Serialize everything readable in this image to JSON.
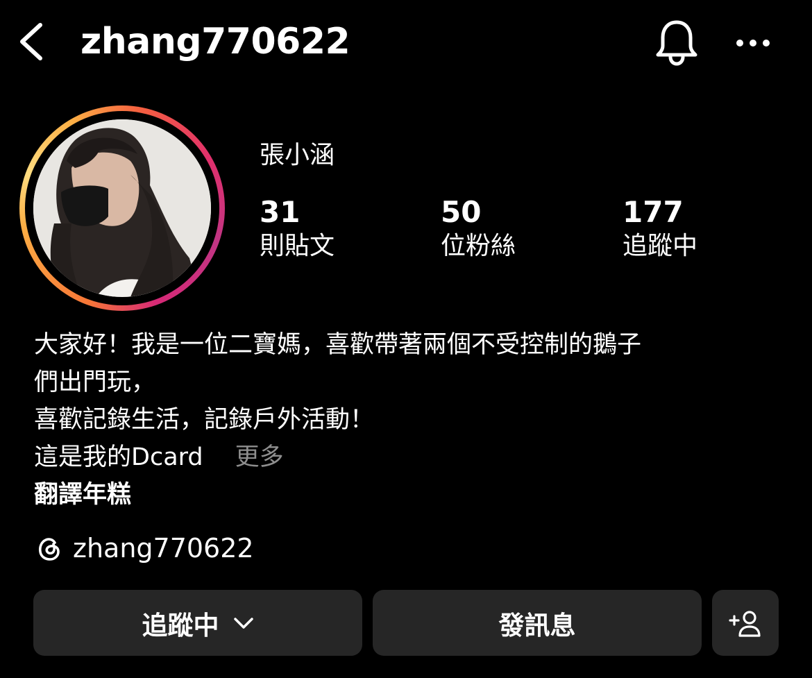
{
  "header": {
    "username": "zhang770622",
    "back_icon": "chevron-left-icon",
    "bell_icon": "bell-icon",
    "more_icon": "more-horizontal-icon"
  },
  "profile": {
    "display_name": "張小涵",
    "story_ring_colors": [
      "#fcaf45",
      "#f77737",
      "#e1306c",
      "#c13584"
    ],
    "stats": [
      {
        "count": "31",
        "label": "則貼文"
      },
      {
        "count": "50",
        "label": "位粉絲"
      },
      {
        "count": "177",
        "label": "追蹤中"
      }
    ]
  },
  "bio": {
    "lines": [
      "大家好！我是一位二寶媽，喜歡帶著兩個不受控制的鵝子",
      "們出門玩，",
      "喜歡記錄生活，記錄戶外活動！",
      "這是我的Dcard"
    ],
    "more_label": "更多",
    "translate_label": "翻譯年糕"
  },
  "threads": {
    "icon": "threads-icon",
    "handle": "zhang770622"
  },
  "actions": {
    "following_label": "追蹤中",
    "message_label": "發訊息",
    "add_user_icon": "add-user-icon"
  }
}
